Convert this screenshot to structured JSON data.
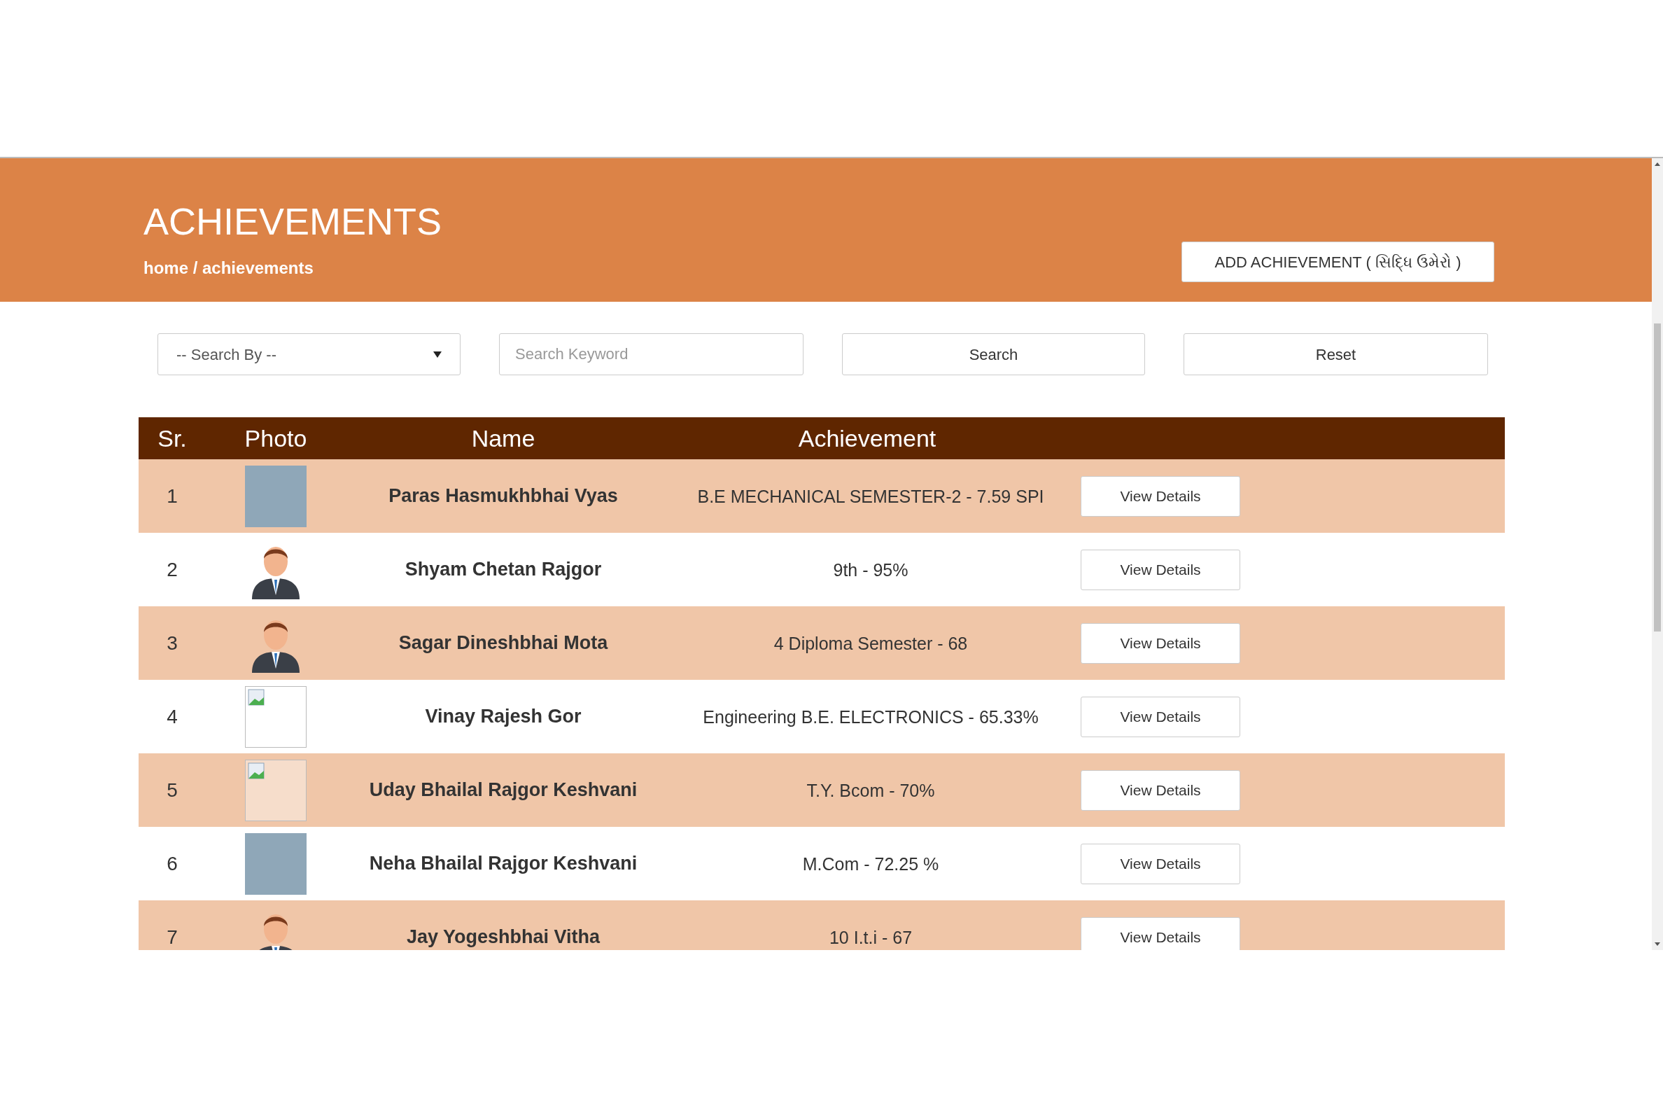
{
  "header": {
    "title": "ACHIEVEMENTS",
    "breadcrumb": "home / achievements",
    "add_button": "ADD ACHIEVEMENT ( સિદ્ધિ ઉમેરો )"
  },
  "search": {
    "search_by": "-- Search By --",
    "keyword_placeholder": "Search Keyword",
    "search_button": "Search",
    "reset_button": "Reset"
  },
  "table": {
    "columns": [
      "Sr.",
      "Photo",
      "Name",
      "Achievement"
    ],
    "rows": [
      {
        "sr": "1",
        "kind": "photo",
        "name": "Paras Hasmukhbhai Vyas",
        "achievement": "B.E MECHANICAL SEMESTER-2 - 7.59 SPI",
        "action": "View Details"
      },
      {
        "sr": "2",
        "kind": "avatar",
        "name": "Shyam Chetan Rajgor",
        "achievement": "9th - 95%",
        "action": "View Details"
      },
      {
        "sr": "3",
        "kind": "avatar",
        "name": "Sagar Dineshbhai Mota",
        "achievement": "4 Diploma Semester - 68",
        "action": "View Details"
      },
      {
        "sr": "4",
        "kind": "broken",
        "name": "Vinay Rajesh Gor",
        "achievement": "Engineering B.E. ELECTRONICS - 65.33%",
        "action": "View Details"
      },
      {
        "sr": "5",
        "kind": "broken",
        "name": "Uday Bhailal Rajgor Keshvani",
        "achievement": "T.Y. Bcom - 70%",
        "action": "View Details"
      },
      {
        "sr": "6",
        "kind": "photo",
        "name": "Neha Bhailal Rajgor Keshvani",
        "achievement": "M.Com - 72.25 %",
        "action": "View Details"
      },
      {
        "sr": "7",
        "kind": "avatar",
        "name": "Jay Yogeshbhai Vitha",
        "achievement": "10 I.t.i - 67",
        "action": "View Details"
      }
    ]
  }
}
